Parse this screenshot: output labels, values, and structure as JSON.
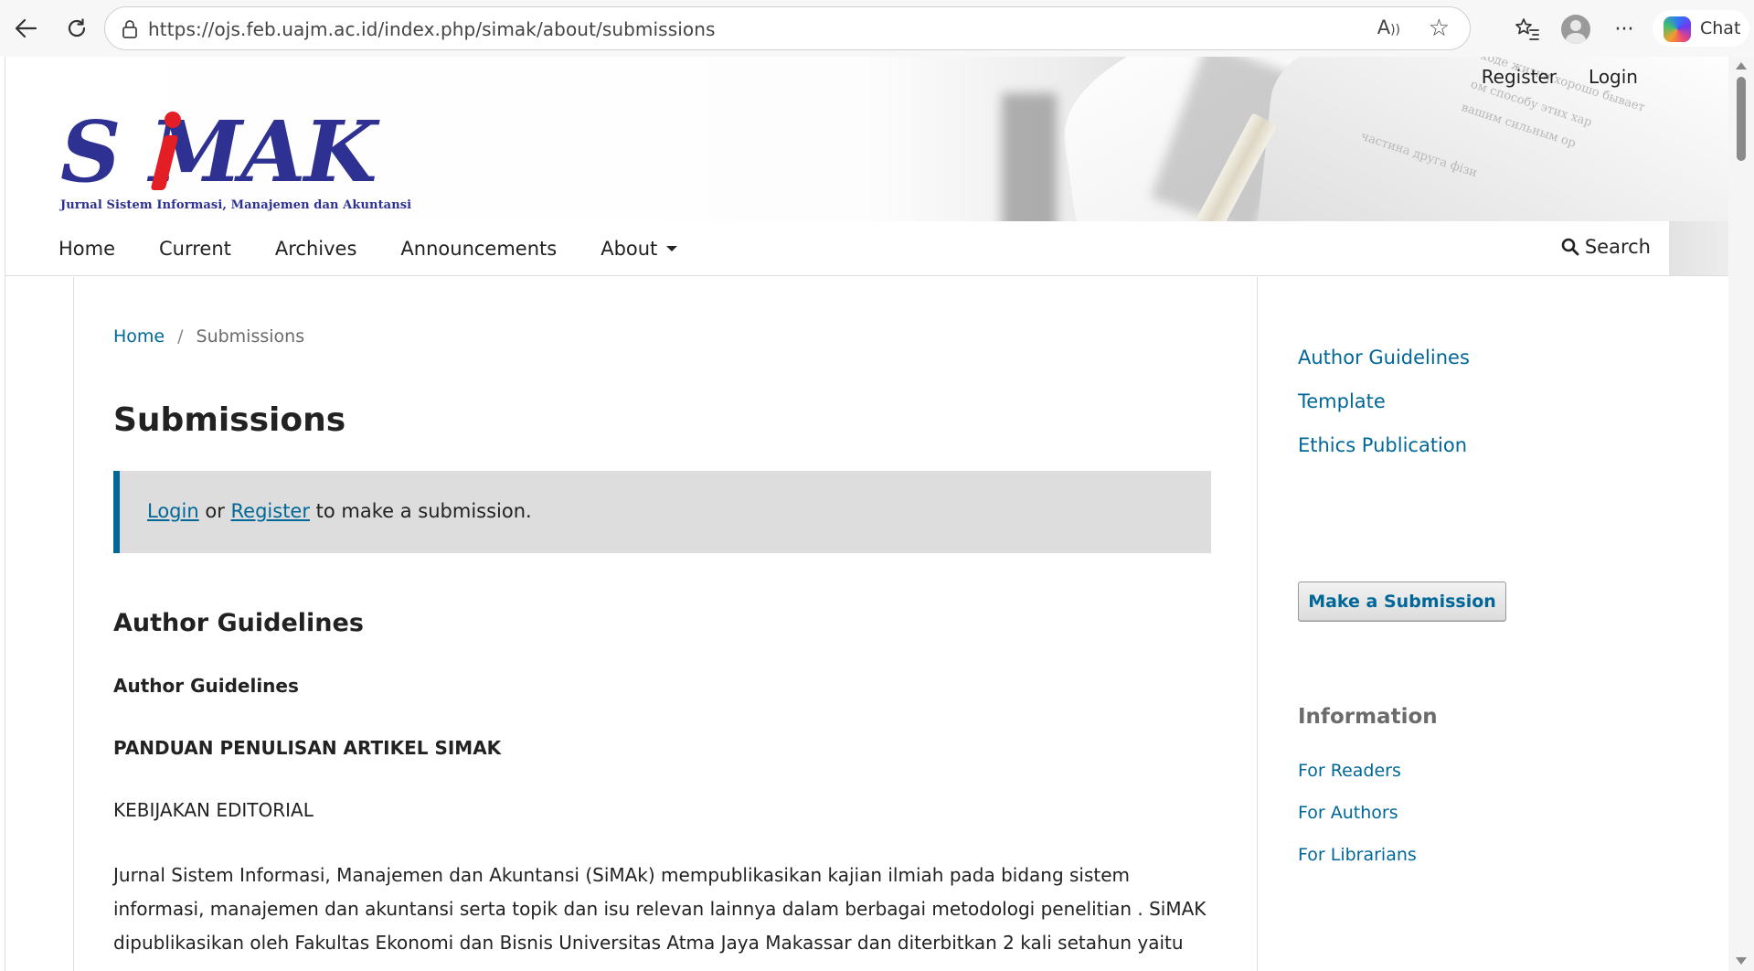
{
  "browser": {
    "url": "https://ojs.feb.uajm.ac.id/index.php/simak/about/submissions",
    "chat_label": "Chat"
  },
  "header": {
    "user_nav": {
      "register": "Register",
      "login": "Login"
    },
    "logo": {
      "wordmark": "SiMAK",
      "tagline": "Jurnal Sistem Informasi, Manajemen dan Akuntansi",
      "colors": {
        "primary": "#2e3192",
        "accent": "#e31e24"
      }
    },
    "main_nav": {
      "home": "Home",
      "current": "Current",
      "archives": "Archives",
      "announcements": "Announcements",
      "about": "About",
      "search": "Search"
    }
  },
  "breadcrumb": {
    "home": "Home",
    "separator": "/",
    "current": "Submissions"
  },
  "main": {
    "title": "Submissions",
    "notice": {
      "login": "Login",
      "or": "or",
      "register": "Register",
      "rest": "to make a submission."
    },
    "section_heading": "Author Guidelines",
    "sub_heading": "Author Guidelines",
    "sub_heading_2": "PANDUAN PENULISAN ARTIKEL SIMAK",
    "policy_heading": "KEBIJAKAN EDITORIAL",
    "paragraph": "Jurnal Sistem Informasi, Manajemen dan Akuntansi (SiMAk)  mempublikasikan kajian  ilmiah pada bidang sistem informasi, manajemen dan akuntansi serta topik dan isu relevan lainnya dalam berbagai metodologi penelitian . SiMAK dipublikasikan oleh Fakultas Ekonomi dan Bisnis Universitas Atma  Jaya Makassar dan diterbitkan 2 kali setahun yaitu"
  },
  "sidebar": {
    "links": [
      "Author Guidelines",
      "Template",
      "Ethics Publication"
    ],
    "submit_button": "Make a Submission",
    "info_heading": "Information",
    "info_links": [
      "For Readers",
      "For Authors",
      "For Librarians"
    ]
  },
  "colors": {
    "link": "#006798",
    "notice_bg": "#dddddd",
    "text": "#222222"
  }
}
